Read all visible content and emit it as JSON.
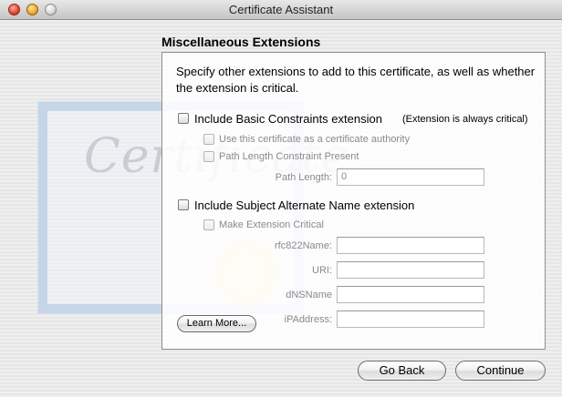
{
  "window": {
    "title": "Certificate Assistant"
  },
  "background": {
    "watermark_word": "Certificate"
  },
  "section": {
    "heading": "Miscellaneous Extensions",
    "description": "Specify other extensions to add to this certificate, as well as whether the extension is critical."
  },
  "basic_constraints": {
    "label": "Include Basic Constraints extension",
    "note": "(Extension is always critical)",
    "ca_label": "Use this certificate as a certificate authority",
    "path_constraint_label": "Path Length Constraint Present",
    "path_length_label": "Path Length:",
    "path_length_value": "0"
  },
  "subject_alt_name": {
    "label": "Include Subject Alternate Name extension",
    "critical_label": "Make Extension Critical",
    "rfc822_label": "rfc822Name:",
    "uri_label": "URI:",
    "dnsname_label": "dNSName",
    "ipaddress_label": "iPAddress:"
  },
  "buttons": {
    "learn_more": "Learn More...",
    "go_back": "Go Back",
    "continue": "Continue"
  }
}
